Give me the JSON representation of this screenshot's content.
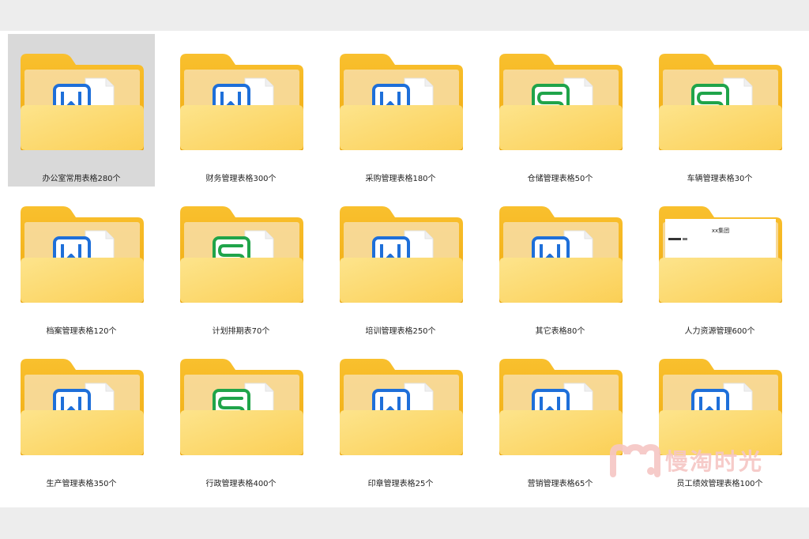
{
  "window": {
    "background": "#ededed",
    "content_background": "#ffffff",
    "selection_color": "#d9d9d9"
  },
  "folders": [
    {
      "label": "办公室常用表格280个",
      "icon": "word-doc-icon",
      "selected": true
    },
    {
      "label": "财务管理表格300个",
      "icon": "word-doc-icon",
      "selected": false
    },
    {
      "label": "采购管理表格180个",
      "icon": "word-doc-icon",
      "selected": false
    },
    {
      "label": "仓储管理表格50个",
      "icon": "excel-sheet-icon",
      "selected": false
    },
    {
      "label": "车辆管理表格30个",
      "icon": "excel-sheet-icon",
      "selected": false
    },
    {
      "label": "档案管理表格120个",
      "icon": "word-doc-icon",
      "selected": false
    },
    {
      "label": "计划排期表70个",
      "icon": "excel-sheet-icon",
      "selected": false
    },
    {
      "label": "培训管理表格250个",
      "icon": "word-doc-icon",
      "selected": false
    },
    {
      "label": "其它表格80个",
      "icon": "word-doc-icon",
      "selected": false
    },
    {
      "label": "人力资源管理600个",
      "icon": "document-preview-icon",
      "selected": false,
      "preview_text": "xx集团"
    },
    {
      "label": "生产管理表格350个",
      "icon": "word-doc-icon",
      "selected": false
    },
    {
      "label": "行政管理表格400个",
      "icon": "excel-sheet-icon",
      "selected": false
    },
    {
      "label": "印章管理表格25个",
      "icon": "word-doc-icon",
      "selected": false
    },
    {
      "label": "营销管理表格65个",
      "icon": "word-doc-icon",
      "selected": false
    },
    {
      "label": "员工绩效管理表格100个",
      "icon": "word-doc-icon",
      "selected": false
    }
  ],
  "watermark": {
    "text": "慢淘时光",
    "icon": "m-logo-icon"
  },
  "colors": {
    "folder_back": "#f4b41a",
    "folder_front": "#fcd667",
    "word_blue": "#1e6fd9",
    "excel_green": "#20a44a"
  }
}
